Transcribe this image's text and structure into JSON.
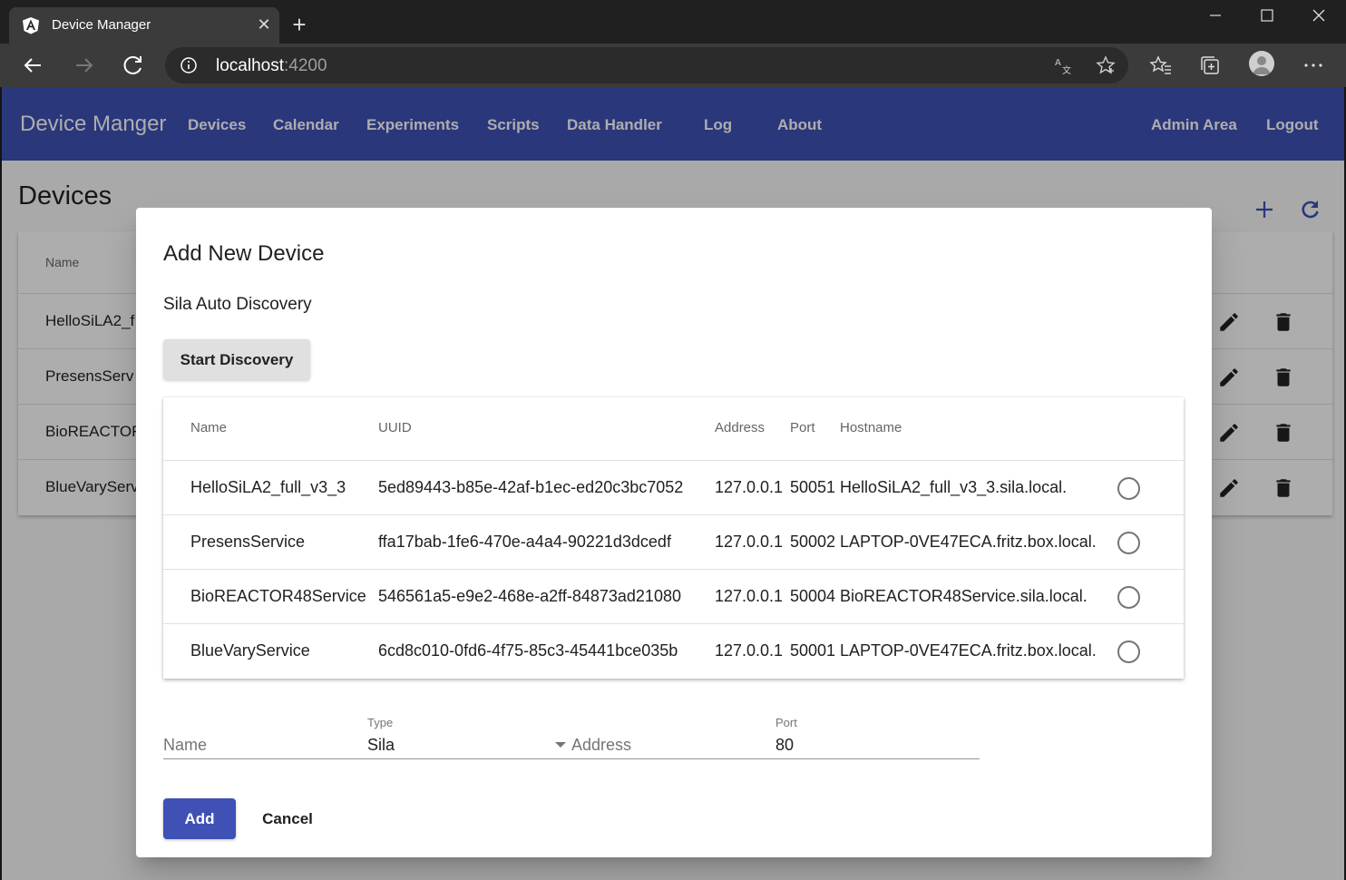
{
  "browser": {
    "tab_title": "Device Manager",
    "url_host": "localhost",
    "url_port": ":4200",
    "icons": {
      "tab_logo": "angular-logo-icon",
      "tab_close": "close-icon",
      "new_tab": "plus-icon",
      "back": "back-arrow-icon",
      "forward": "forward-arrow-icon",
      "reload": "reload-icon",
      "site_info": "info-icon",
      "translate": "translate-icon",
      "favorite": "star-icon",
      "favorites_bar": "favorites-icon",
      "collections": "collections-icon",
      "profile": "profile-avatar-icon",
      "menu": "more-dots-icon"
    }
  },
  "app": {
    "brand": "Device Manger",
    "nav": [
      "Devices",
      "Calendar",
      "Experiments",
      "Scripts",
      "Data Handler",
      "Log",
      "About"
    ],
    "nav_right": [
      "Admin Area",
      "Logout"
    ],
    "page_title": "Devices",
    "table_header_name": "Name",
    "rows": [
      "HelloSiLA2_f",
      "PresensServ",
      "BioREACTOR",
      "BlueVaryServ"
    ],
    "colors": {
      "primary": "#3f51b5"
    }
  },
  "dialog": {
    "title": "Add New Device",
    "subtitle": "Sila Auto Discovery",
    "start_discovery": "Start Discovery",
    "columns": {
      "name": "Name",
      "uuid": "UUID",
      "address": "Address",
      "port": "Port",
      "hostname": "Hostname"
    },
    "devices": [
      {
        "name": "HelloSiLA2_full_v3_3",
        "uuid": "5ed89443-b85e-42af-b1ec-ed20c3bc7052",
        "address": "127.0.0.1",
        "port": "50051",
        "hostname": "HelloSiLA2_full_v3_3.sila.local."
      },
      {
        "name": "PresensService",
        "uuid": "ffa17bab-1fe6-470e-a4a4-90221d3dcedf",
        "address": "127.0.0.1",
        "port": "50002",
        "hostname": "LAPTOP-0VE47ECA.fritz.box.local."
      },
      {
        "name": "BioREACTOR48Service",
        "uuid": "546561a5-e9e2-468e-a2ff-84873ad21080",
        "address": "127.0.0.1",
        "port": "50004",
        "hostname": "BioREACTOR48Service.sila.local."
      },
      {
        "name": "BlueVaryService",
        "uuid": "6cd8c010-0fd6-4f75-85c3-45441bce035b",
        "address": "127.0.0.1",
        "port": "50001",
        "hostname": "LAPTOP-0VE47ECA.fritz.box.local."
      }
    ],
    "form": {
      "name_placeholder": "Name",
      "type_label": "Type",
      "type_value": "Sila",
      "address_placeholder": "Address",
      "port_label": "Port",
      "port_value": "80"
    },
    "add": "Add",
    "cancel": "Cancel"
  }
}
